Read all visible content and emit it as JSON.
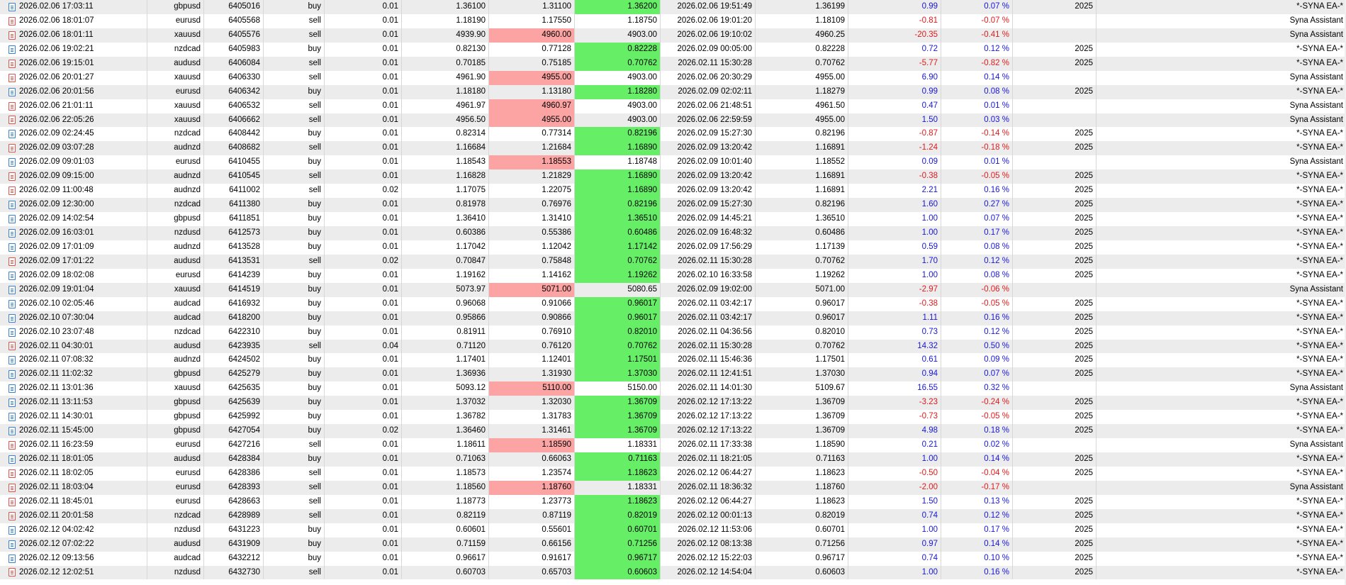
{
  "deals": [
    {
      "open_time": "2026.02.06 17:03:11",
      "symbol": "gbpusd",
      "ticket": "6405016",
      "type": "buy",
      "volume": "0.01",
      "open_price": "1.36100",
      "sl": "1.31100",
      "tp": "1.36200",
      "close_time": "2026.02.06 19:51:49",
      "close_price": "1.36199",
      "profit": "0.99",
      "pct": "0.07 %",
      "magic": "2025",
      "comment": "*-SYNA EA-*",
      "hit": "tp"
    },
    {
      "open_time": "2026.02.06 18:01:07",
      "symbol": "eurusd",
      "ticket": "6405568",
      "type": "sell",
      "volume": "0.01",
      "open_price": "1.18190",
      "sl": "1.17550",
      "tp": "1.18750",
      "close_time": "2026.02.06 19:01:20",
      "close_price": "1.18109",
      "profit": "-0.81",
      "pct": "-0.07 %",
      "magic": "",
      "comment": "Syna Assistant",
      "hit": ""
    },
    {
      "open_time": "2026.02.06 18:01:11",
      "symbol": "xauusd",
      "ticket": "6405576",
      "type": "sell",
      "volume": "0.01",
      "open_price": "4939.90",
      "sl": "4960.00",
      "tp": "4903.00",
      "close_time": "2026.02.06 19:10:02",
      "close_price": "4960.25",
      "profit": "-20.35",
      "pct": "-0.41 %",
      "magic": "",
      "comment": "Syna Assistant",
      "hit": "sl"
    },
    {
      "open_time": "2026.02.06 19:02:21",
      "symbol": "nzdcad",
      "ticket": "6405983",
      "type": "buy",
      "volume": "0.01",
      "open_price": "0.82130",
      "sl": "0.77128",
      "tp": "0.82228",
      "close_time": "2026.02.09 00:05:00",
      "close_price": "0.82228",
      "profit": "0.72",
      "pct": "0.12 %",
      "magic": "2025",
      "comment": "*-SYNA EA-*",
      "hit": "tp"
    },
    {
      "open_time": "2026.02.06 19:15:01",
      "symbol": "audusd",
      "ticket": "6406084",
      "type": "sell",
      "volume": "0.01",
      "open_price": "0.70185",
      "sl": "0.75185",
      "tp": "0.70762",
      "close_time": "2026.02.11 15:30:28",
      "close_price": "0.70762",
      "profit": "-5.77",
      "pct": "-0.82 %",
      "magic": "2025",
      "comment": "*-SYNA EA-*",
      "hit": "tp"
    },
    {
      "open_time": "2026.02.06 20:01:27",
      "symbol": "xauusd",
      "ticket": "6406330",
      "type": "sell",
      "volume": "0.01",
      "open_price": "4961.90",
      "sl": "4955.00",
      "tp": "4903.00",
      "close_time": "2026.02.06 20:30:29",
      "close_price": "4955.00",
      "profit": "6.90",
      "pct": "0.14 %",
      "magic": "",
      "comment": "Syna Assistant",
      "hit": "sl"
    },
    {
      "open_time": "2026.02.06 20:01:56",
      "symbol": "eurusd",
      "ticket": "6406342",
      "type": "buy",
      "volume": "0.01",
      "open_price": "1.18180",
      "sl": "1.13180",
      "tp": "1.18280",
      "close_time": "2026.02.09 02:02:11",
      "close_price": "1.18279",
      "profit": "0.99",
      "pct": "0.08 %",
      "magic": "2025",
      "comment": "*-SYNA EA-*",
      "hit": "tp"
    },
    {
      "open_time": "2026.02.06 21:01:11",
      "symbol": "xauusd",
      "ticket": "6406532",
      "type": "sell",
      "volume": "0.01",
      "open_price": "4961.97",
      "sl": "4960.97",
      "tp": "4903.00",
      "close_time": "2026.02.06 21:48:51",
      "close_price": "4961.50",
      "profit": "0.47",
      "pct": "0.01 %",
      "magic": "",
      "comment": "Syna Assistant",
      "hit": "sl"
    },
    {
      "open_time": "2026.02.06 22:05:26",
      "symbol": "xauusd",
      "ticket": "6406662",
      "type": "sell",
      "volume": "0.01",
      "open_price": "4956.50",
      "sl": "4955.00",
      "tp": "4903.00",
      "close_time": "2026.02.06 22:59:59",
      "close_price": "4955.00",
      "profit": "1.50",
      "pct": "0.03 %",
      "magic": "",
      "comment": "Syna Assistant",
      "hit": "sl"
    },
    {
      "open_time": "2026.02.09 02:24:45",
      "symbol": "nzdcad",
      "ticket": "6408442",
      "type": "buy",
      "volume": "0.01",
      "open_price": "0.82314",
      "sl": "0.77314",
      "tp": "0.82196",
      "close_time": "2026.02.09 15:27:30",
      "close_price": "0.82196",
      "profit": "-0.87",
      "pct": "-0.14 %",
      "magic": "2025",
      "comment": "*-SYNA EA-*",
      "hit": "tp"
    },
    {
      "open_time": "2026.02.09 03:07:28",
      "symbol": "audnzd",
      "ticket": "6408682",
      "type": "sell",
      "volume": "0.01",
      "open_price": "1.16684",
      "sl": "1.21684",
      "tp": "1.16890",
      "close_time": "2026.02.09 13:20:42",
      "close_price": "1.16891",
      "profit": "-1.24",
      "pct": "-0.18 %",
      "magic": "2025",
      "comment": "*-SYNA EA-*",
      "hit": "tp"
    },
    {
      "open_time": "2026.02.09 09:01:03",
      "symbol": "eurusd",
      "ticket": "6410455",
      "type": "buy",
      "volume": "0.01",
      "open_price": "1.18543",
      "sl": "1.18553",
      "tp": "1.18748",
      "close_time": "2026.02.09 10:01:40",
      "close_price": "1.18552",
      "profit": "0.09",
      "pct": "0.01 %",
      "magic": "",
      "comment": "Syna Assistant",
      "hit": "sl"
    },
    {
      "open_time": "2026.02.09 09:15:00",
      "symbol": "audnzd",
      "ticket": "6410545",
      "type": "sell",
      "volume": "0.01",
      "open_price": "1.16828",
      "sl": "1.21829",
      "tp": "1.16890",
      "close_time": "2026.02.09 13:20:42",
      "close_price": "1.16891",
      "profit": "-0.38",
      "pct": "-0.05 %",
      "magic": "2025",
      "comment": "*-SYNA EA-*",
      "hit": "tp"
    },
    {
      "open_time": "2026.02.09 11:00:48",
      "symbol": "audnzd",
      "ticket": "6411002",
      "type": "sell",
      "volume": "0.02",
      "open_price": "1.17075",
      "sl": "1.22075",
      "tp": "1.16890",
      "close_time": "2026.02.09 13:20:42",
      "close_price": "1.16891",
      "profit": "2.21",
      "pct": "0.16 %",
      "magic": "2025",
      "comment": "*-SYNA EA-*",
      "hit": "tp"
    },
    {
      "open_time": "2026.02.09 12:30:00",
      "symbol": "nzdcad",
      "ticket": "6411380",
      "type": "buy",
      "volume": "0.01",
      "open_price": "0.81978",
      "sl": "0.76976",
      "tp": "0.82196",
      "close_time": "2026.02.09 15:27:30",
      "close_price": "0.82196",
      "profit": "1.60",
      "pct": "0.27 %",
      "magic": "2025",
      "comment": "*-SYNA EA-*",
      "hit": "tp"
    },
    {
      "open_time": "2026.02.09 14:02:54",
      "symbol": "gbpusd",
      "ticket": "6411851",
      "type": "buy",
      "volume": "0.01",
      "open_price": "1.36410",
      "sl": "1.31410",
      "tp": "1.36510",
      "close_time": "2026.02.09 14:45:21",
      "close_price": "1.36510",
      "profit": "1.00",
      "pct": "0.07 %",
      "magic": "2025",
      "comment": "*-SYNA EA-*",
      "hit": "tp"
    },
    {
      "open_time": "2026.02.09 16:03:01",
      "symbol": "nzdusd",
      "ticket": "6412573",
      "type": "buy",
      "volume": "0.01",
      "open_price": "0.60386",
      "sl": "0.55386",
      "tp": "0.60486",
      "close_time": "2026.02.09 16:48:32",
      "close_price": "0.60486",
      "profit": "1.00",
      "pct": "0.17 %",
      "magic": "2025",
      "comment": "*-SYNA EA-*",
      "hit": "tp"
    },
    {
      "open_time": "2026.02.09 17:01:09",
      "symbol": "audnzd",
      "ticket": "6413528",
      "type": "buy",
      "volume": "0.01",
      "open_price": "1.17042",
      "sl": "1.12042",
      "tp": "1.17142",
      "close_time": "2026.02.09 17:56:29",
      "close_price": "1.17139",
      "profit": "0.59",
      "pct": "0.08 %",
      "magic": "2025",
      "comment": "*-SYNA EA-*",
      "hit": "tp"
    },
    {
      "open_time": "2026.02.09 17:01:22",
      "symbol": "audusd",
      "ticket": "6413531",
      "type": "sell",
      "volume": "0.02",
      "open_price": "0.70847",
      "sl": "0.75848",
      "tp": "0.70762",
      "close_time": "2026.02.11 15:30:28",
      "close_price": "0.70762",
      "profit": "1.70",
      "pct": "0.12 %",
      "magic": "2025",
      "comment": "*-SYNA EA-*",
      "hit": "tp"
    },
    {
      "open_time": "2026.02.09 18:02:08",
      "symbol": "eurusd",
      "ticket": "6414239",
      "type": "buy",
      "volume": "0.01",
      "open_price": "1.19162",
      "sl": "1.14162",
      "tp": "1.19262",
      "close_time": "2026.02.10 16:33:58",
      "close_price": "1.19262",
      "profit": "1.00",
      "pct": "0.08 %",
      "magic": "2025",
      "comment": "*-SYNA EA-*",
      "hit": "tp"
    },
    {
      "open_time": "2026.02.09 19:01:04",
      "symbol": "xauusd",
      "ticket": "6414519",
      "type": "buy",
      "volume": "0.01",
      "open_price": "5073.97",
      "sl": "5071.00",
      "tp": "5080.65",
      "close_time": "2026.02.09 19:02:00",
      "close_price": "5071.00",
      "profit": "-2.97",
      "pct": "-0.06 %",
      "magic": "",
      "comment": "Syna Assistant",
      "hit": "sl"
    },
    {
      "open_time": "2026.02.10 02:05:46",
      "symbol": "audcad",
      "ticket": "6416932",
      "type": "buy",
      "volume": "0.01",
      "open_price": "0.96068",
      "sl": "0.91066",
      "tp": "0.96017",
      "close_time": "2026.02.11 03:42:17",
      "close_price": "0.96017",
      "profit": "-0.38",
      "pct": "-0.05 %",
      "magic": "2025",
      "comment": "*-SYNA EA-*",
      "hit": "tp"
    },
    {
      "open_time": "2026.02.10 07:30:04",
      "symbol": "audcad",
      "ticket": "6418200",
      "type": "buy",
      "volume": "0.01",
      "open_price": "0.95866",
      "sl": "0.90866",
      "tp": "0.96017",
      "close_time": "2026.02.11 03:42:17",
      "close_price": "0.96017",
      "profit": "1.11",
      "pct": "0.16 %",
      "magic": "2025",
      "comment": "*-SYNA EA-*",
      "hit": "tp"
    },
    {
      "open_time": "2026.02.10 23:07:48",
      "symbol": "nzdcad",
      "ticket": "6422310",
      "type": "buy",
      "volume": "0.01",
      "open_price": "0.81911",
      "sl": "0.76910",
      "tp": "0.82010",
      "close_time": "2026.02.11 04:36:56",
      "close_price": "0.82010",
      "profit": "0.73",
      "pct": "0.12 %",
      "magic": "2025",
      "comment": "*-SYNA EA-*",
      "hit": "tp"
    },
    {
      "open_time": "2026.02.11 04:30:01",
      "symbol": "audusd",
      "ticket": "6423935",
      "type": "sell",
      "volume": "0.04",
      "open_price": "0.71120",
      "sl": "0.76120",
      "tp": "0.70762",
      "close_time": "2026.02.11 15:30:28",
      "close_price": "0.70762",
      "profit": "14.32",
      "pct": "0.50 %",
      "magic": "2025",
      "comment": "*-SYNA EA-*",
      "hit": "tp"
    },
    {
      "open_time": "2026.02.11 07:08:32",
      "symbol": "audnzd",
      "ticket": "6424502",
      "type": "buy",
      "volume": "0.01",
      "open_price": "1.17401",
      "sl": "1.12401",
      "tp": "1.17501",
      "close_time": "2026.02.11 15:46:36",
      "close_price": "1.17501",
      "profit": "0.61",
      "pct": "0.09 %",
      "magic": "2025",
      "comment": "*-SYNA EA-*",
      "hit": "tp"
    },
    {
      "open_time": "2026.02.11 11:02:32",
      "symbol": "gbpusd",
      "ticket": "6425279",
      "type": "buy",
      "volume": "0.01",
      "open_price": "1.36936",
      "sl": "1.31930",
      "tp": "1.37030",
      "close_time": "2026.02.11 12:41:51",
      "close_price": "1.37030",
      "profit": "0.94",
      "pct": "0.07 %",
      "magic": "2025",
      "comment": "*-SYNA EA-*",
      "hit": "tp"
    },
    {
      "open_time": "2026.02.11 13:01:36",
      "symbol": "xauusd",
      "ticket": "6425635",
      "type": "buy",
      "volume": "0.01",
      "open_price": "5093.12",
      "sl": "5110.00",
      "tp": "5150.00",
      "close_time": "2026.02.11 14:01:30",
      "close_price": "5109.67",
      "profit": "16.55",
      "pct": "0.32 %",
      "magic": "",
      "comment": "Syna Assistant",
      "hit": "sl"
    },
    {
      "open_time": "2026.02.11 13:11:53",
      "symbol": "gbpusd",
      "ticket": "6425639",
      "type": "buy",
      "volume": "0.01",
      "open_price": "1.37032",
      "sl": "1.32030",
      "tp": "1.36709",
      "close_time": "2026.02.12 17:13:22",
      "close_price": "1.36709",
      "profit": "-3.23",
      "pct": "-0.24 %",
      "magic": "2025",
      "comment": "*-SYNA EA-*",
      "hit": "tp"
    },
    {
      "open_time": "2026.02.11 14:30:01",
      "symbol": "gbpusd",
      "ticket": "6425992",
      "type": "buy",
      "volume": "0.01",
      "open_price": "1.36782",
      "sl": "1.31783",
      "tp": "1.36709",
      "close_time": "2026.02.12 17:13:22",
      "close_price": "1.36709",
      "profit": "-0.73",
      "pct": "-0.05 %",
      "magic": "2025",
      "comment": "*-SYNA EA-*",
      "hit": "tp"
    },
    {
      "open_time": "2026.02.11 15:45:00",
      "symbol": "gbpusd",
      "ticket": "6427054",
      "type": "buy",
      "volume": "0.02",
      "open_price": "1.36460",
      "sl": "1.31461",
      "tp": "1.36709",
      "close_time": "2026.02.12 17:13:22",
      "close_price": "1.36709",
      "profit": "4.98",
      "pct": "0.18 %",
      "magic": "2025",
      "comment": "*-SYNA EA-*",
      "hit": "tp"
    },
    {
      "open_time": "2026.02.11 16:23:59",
      "symbol": "eurusd",
      "ticket": "6427216",
      "type": "sell",
      "volume": "0.01",
      "open_price": "1.18611",
      "sl": "1.18590",
      "tp": "1.18331",
      "close_time": "2026.02.11 17:33:38",
      "close_price": "1.18590",
      "profit": "0.21",
      "pct": "0.02 %",
      "magic": "",
      "comment": "Syna Assistant",
      "hit": "sl"
    },
    {
      "open_time": "2026.02.11 18:01:05",
      "symbol": "audusd",
      "ticket": "6428384",
      "type": "buy",
      "volume": "0.01",
      "open_price": "0.71063",
      "sl": "0.66063",
      "tp": "0.71163",
      "close_time": "2026.02.11 18:21:05",
      "close_price": "0.71163",
      "profit": "1.00",
      "pct": "0.14 %",
      "magic": "2025",
      "comment": "*-SYNA EA-*",
      "hit": "tp"
    },
    {
      "open_time": "2026.02.11 18:02:05",
      "symbol": "eurusd",
      "ticket": "6428386",
      "type": "sell",
      "volume": "0.01",
      "open_price": "1.18573",
      "sl": "1.23574",
      "tp": "1.18623",
      "close_time": "2026.02.12 06:44:27",
      "close_price": "1.18623",
      "profit": "-0.50",
      "pct": "-0.04 %",
      "magic": "2025",
      "comment": "*-SYNA EA-*",
      "hit": "tp"
    },
    {
      "open_time": "2026.02.11 18:03:04",
      "symbol": "eurusd",
      "ticket": "6428393",
      "type": "sell",
      "volume": "0.01",
      "open_price": "1.18560",
      "sl": "1.18760",
      "tp": "1.18331",
      "close_time": "2026.02.11 18:36:32",
      "close_price": "1.18760",
      "profit": "-2.00",
      "pct": "-0.17 %",
      "magic": "",
      "comment": "Syna Assistant",
      "hit": "sl"
    },
    {
      "open_time": "2026.02.11 18:45:01",
      "symbol": "eurusd",
      "ticket": "6428663",
      "type": "sell",
      "volume": "0.01",
      "open_price": "1.18773",
      "sl": "1.23773",
      "tp": "1.18623",
      "close_time": "2026.02.12 06:44:27",
      "close_price": "1.18623",
      "profit": "1.50",
      "pct": "0.13 %",
      "magic": "2025",
      "comment": "*-SYNA EA-*",
      "hit": "tp"
    },
    {
      "open_time": "2026.02.11 20:01:58",
      "symbol": "nzdcad",
      "ticket": "6428989",
      "type": "sell",
      "volume": "0.01",
      "open_price": "0.82119",
      "sl": "0.87119",
      "tp": "0.82019",
      "close_time": "2026.02.12 00:01:13",
      "close_price": "0.82019",
      "profit": "0.74",
      "pct": "0.12 %",
      "magic": "2025",
      "comment": "*-SYNA EA-*",
      "hit": "tp"
    },
    {
      "open_time": "2026.02.12 04:02:42",
      "symbol": "nzdusd",
      "ticket": "6431223",
      "type": "buy",
      "volume": "0.01",
      "open_price": "0.60601",
      "sl": "0.55601",
      "tp": "0.60701",
      "close_time": "2026.02.12 11:53:06",
      "close_price": "0.60701",
      "profit": "1.00",
      "pct": "0.17 %",
      "magic": "2025",
      "comment": "*-SYNA EA-*",
      "hit": "tp"
    },
    {
      "open_time": "2026.02.12 07:02:22",
      "symbol": "audusd",
      "ticket": "6431909",
      "type": "buy",
      "volume": "0.01",
      "open_price": "0.71159",
      "sl": "0.66156",
      "tp": "0.71256",
      "close_time": "2026.02.12 08:13:38",
      "close_price": "0.71256",
      "profit": "0.97",
      "pct": "0.14 %",
      "magic": "2025",
      "comment": "*-SYNA EA-*",
      "hit": "tp"
    },
    {
      "open_time": "2026.02.12 09:13:56",
      "symbol": "audcad",
      "ticket": "6432212",
      "type": "buy",
      "volume": "0.01",
      "open_price": "0.96617",
      "sl": "0.91617",
      "tp": "0.96717",
      "close_time": "2026.02.12 15:22:03",
      "close_price": "0.96717",
      "profit": "0.74",
      "pct": "0.10 %",
      "magic": "2025",
      "comment": "*-SYNA EA-*",
      "hit": "tp"
    },
    {
      "open_time": "2026.02.12 12:02:51",
      "symbol": "nzdusd",
      "ticket": "6432730",
      "type": "sell",
      "volume": "0.01",
      "open_price": "0.60703",
      "sl": "0.65703",
      "tp": "0.60603",
      "close_time": "2026.02.12 14:54:04",
      "close_price": "0.60603",
      "profit": "1.00",
      "pct": "0.16 %",
      "magic": "2025",
      "comment": "*-SYNA EA-*",
      "hit": "tp"
    }
  ],
  "colors": {
    "row_alt": "#ececec",
    "sl_highlight": "#fca3a3",
    "tp_highlight": "#66ee66",
    "positive_text": "#1717d8",
    "negative_text": "#e01b1b",
    "buy_icon": "#3a7fd5",
    "sell_icon": "#e0524a"
  },
  "icons": {
    "buy": "document-blue-icon",
    "sell": "document-red-icon"
  }
}
